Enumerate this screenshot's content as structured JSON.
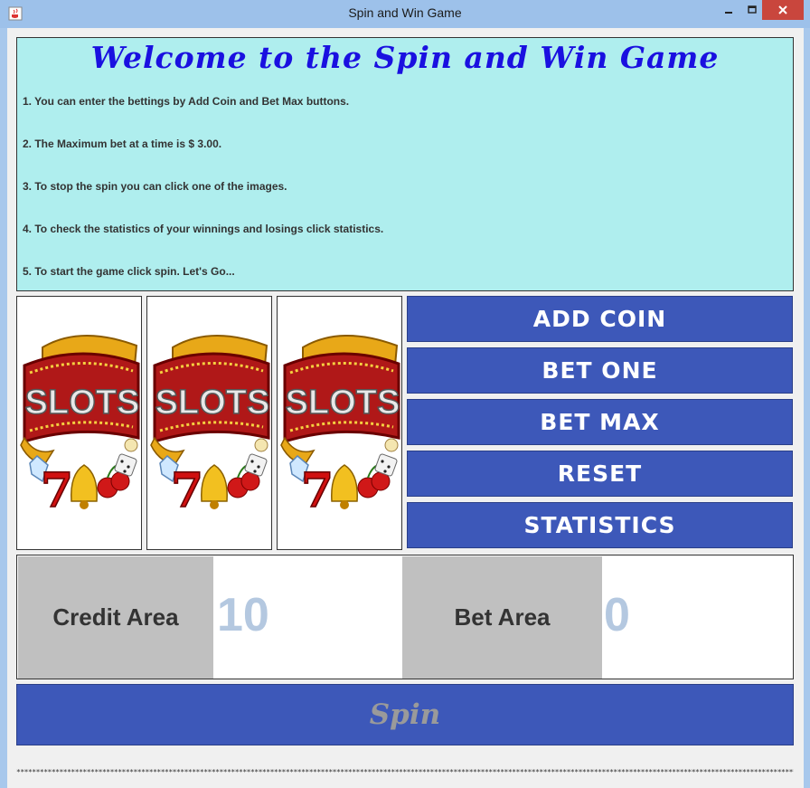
{
  "window": {
    "title": "Spin and Win Game",
    "icon": "java-cup-icon"
  },
  "welcome": {
    "title": "Welcome to the Spin and Win Game",
    "instructions": [
      "1. You can enter the bettings by Add Coin and Bet Max buttons.",
      "2. The Maximum bet at a time is $ 3.00.",
      "3. To stop the spin you can click one of the images.",
      "4. To check the statistics of your winnings and losings click statistics.",
      "5. To start the game click spin. Let's Go..."
    ]
  },
  "reels": [
    {
      "label": "SLOTS",
      "number": "7",
      "icon": "slots-reel-icon"
    },
    {
      "label": "SLOTS",
      "number": "7",
      "icon": "slots-reel-icon"
    },
    {
      "label": "SLOTS",
      "number": "7",
      "icon": "slots-reel-icon"
    }
  ],
  "buttons": {
    "add_coin": "ADD COIN",
    "bet_one": "BET ONE",
    "bet_max": "BET MAX",
    "reset": "RESET",
    "statistics": "STATISTICS",
    "spin": "Spin"
  },
  "credit": {
    "label": "Credit Area",
    "value": "10"
  },
  "bet": {
    "label": "Bet Area",
    "value": "0"
  },
  "footer": {
    "separator": "*****************************************************************************************************************************************************************************************************************************"
  },
  "colors": {
    "panel_bg": "#afeeee",
    "button_bg": "#3d58b9",
    "title_color": "#1a10e0",
    "label_box": "#c0c0c0",
    "value_color": "#b4c8e0"
  }
}
